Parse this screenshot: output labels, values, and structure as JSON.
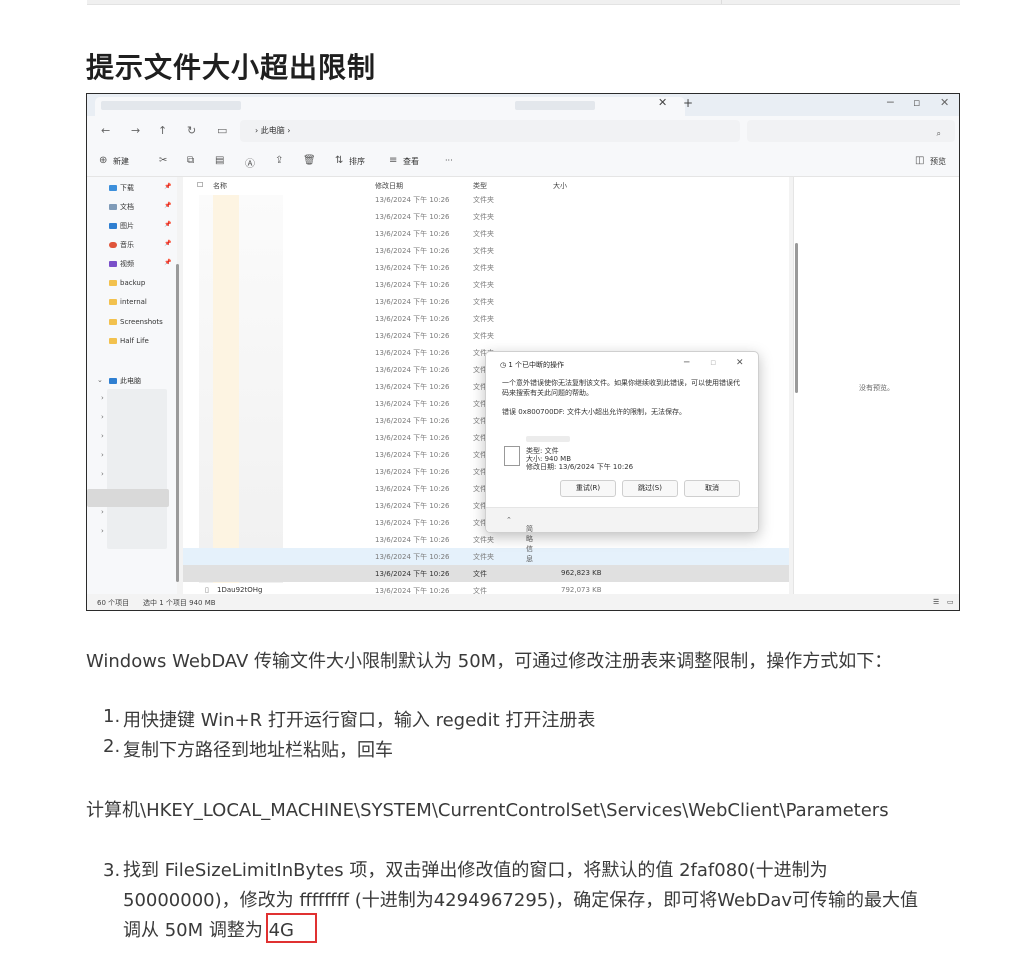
{
  "heading": "提示文件大小超出限制",
  "explorer": {
    "breadcrumb": "此电脑",
    "toolbar": {
      "new": "新建",
      "sort": "排序",
      "view": "查看",
      "more": "···",
      "preview": "预览"
    },
    "nav": [
      {
        "label": "下载",
        "pinned": true
      },
      {
        "label": "文档",
        "pinned": true
      },
      {
        "label": "图片",
        "pinned": true
      },
      {
        "label": "音乐",
        "pinned": true
      },
      {
        "label": "视频",
        "pinned": true
      },
      {
        "label": "backup",
        "pinned": false
      },
      {
        "label": "internal",
        "pinned": false
      },
      {
        "label": "Screenshots",
        "pinned": false
      },
      {
        "label": "Half Life",
        "pinned": false
      },
      {
        "label": "此电脑",
        "pinned": false
      }
    ],
    "columns": [
      "名称",
      "修改日期",
      "类型",
      "大小"
    ],
    "rows": [
      {
        "date": "13/6/2024 下午 10:26",
        "type": "文件夹",
        "size": ""
      },
      {
        "date": "13/6/2024 下午 10:26",
        "type": "文件夹",
        "size": ""
      },
      {
        "date": "13/6/2024 下午 10:26",
        "type": "文件夹",
        "size": ""
      },
      {
        "date": "13/6/2024 下午 10:26",
        "type": "文件夹",
        "size": ""
      },
      {
        "date": "13/6/2024 下午 10:26",
        "type": "文件夹",
        "size": ""
      },
      {
        "date": "13/6/2024 下午 10:26",
        "type": "文件夹",
        "size": ""
      },
      {
        "date": "13/6/2024 下午 10:26",
        "type": "文件夹",
        "size": ""
      },
      {
        "date": "13/6/2024 下午 10:26",
        "type": "文件夹",
        "size": ""
      },
      {
        "date": "13/6/2024 下午 10:26",
        "type": "文件夹",
        "size": ""
      },
      {
        "date": "13/6/2024 下午 10:26",
        "type": "文件夹",
        "size": ""
      },
      {
        "date": "13/6/2024 下午 10:26",
        "type": "文件夹",
        "size": ""
      },
      {
        "date": "13/6/2024 下午 10:26",
        "type": "文件夹",
        "size": ""
      },
      {
        "date": "13/6/2024 下午 10:26",
        "type": "文件夹",
        "size": ""
      },
      {
        "date": "13/6/2024 下午 10:26",
        "type": "文件夹",
        "size": ""
      },
      {
        "date": "13/6/2024 下午 10:26",
        "type": "文件夹",
        "size": ""
      },
      {
        "date": "13/6/2024 下午 10:26",
        "type": "文件夹",
        "size": ""
      },
      {
        "date": "13/6/2024 下午 10:26",
        "type": "文件夹",
        "size": ""
      },
      {
        "date": "13/6/2024 下午 10:26",
        "type": "文件夹",
        "size": ""
      },
      {
        "date": "13/6/2024 下午 10:26",
        "type": "文件夹",
        "size": ""
      },
      {
        "date": "13/6/2024 下午 10:26",
        "type": "文件夹",
        "size": ""
      },
      {
        "date": "13/6/2024 下午 10:26",
        "type": "文件夹",
        "size": ""
      },
      {
        "date": "13/6/2024 下午 10:26",
        "type": "文件夹",
        "size": ""
      },
      {
        "date": "13/6/2024 下午 10:26",
        "type": "文件",
        "size": "962,823 KB"
      },
      {
        "name": "1Dau92tOHg",
        "date": "13/6/2024 下午 10:26",
        "type": "文件",
        "size": "792,073 KB"
      }
    ],
    "preview_empty": "没有预览。",
    "status": {
      "count": "60 个项目",
      "selected": "选中 1 个项目  940 MB"
    },
    "dialog": {
      "title": "1 个已中断的操作",
      "message": "一个意外错误使你无法复制该文件。如果你继续收到此错误，可以使用错误代码来搜索有关此问题的帮助。",
      "error": "错误 0x800700DF: 文件大小超出允许的限制，无法保存。",
      "file_type": "类型: 文件",
      "file_size": "大小: 940 MB",
      "file_date": "修改日期: 13/6/2024 下午 10:26",
      "retry": "重试(R)",
      "skip": "跳过(S)",
      "cancel": "取消",
      "details": "简略信息"
    }
  },
  "intro": "Windows WebDAV 传输文件大小限制默认为 50M，可通过修改注册表来调整限制，操作方式如下：",
  "steps": [
    "用快捷键 Win+R 打开运行窗口，输入 regedit 打开注册表",
    "复制下方路径到地址栏粘贴，回车"
  ],
  "registry_path": "计算机\\HKEY_LOCAL_MACHINE\\SYSTEM\\CurrentControlSet\\Services\\WebClient\\Parameters",
  "step3": {
    "number": "3.",
    "line1": "找到 FileSizeLimitInBytes 项，双击弹出修改值的窗口，将默认的值 2faf080(十进制为",
    "line2": "50000000)，修改为 ffffffff (十进制为4294967295)，确定保存，即可将WebDav可传输的最大值",
    "line3": "调从 50M 调整为 4G"
  }
}
